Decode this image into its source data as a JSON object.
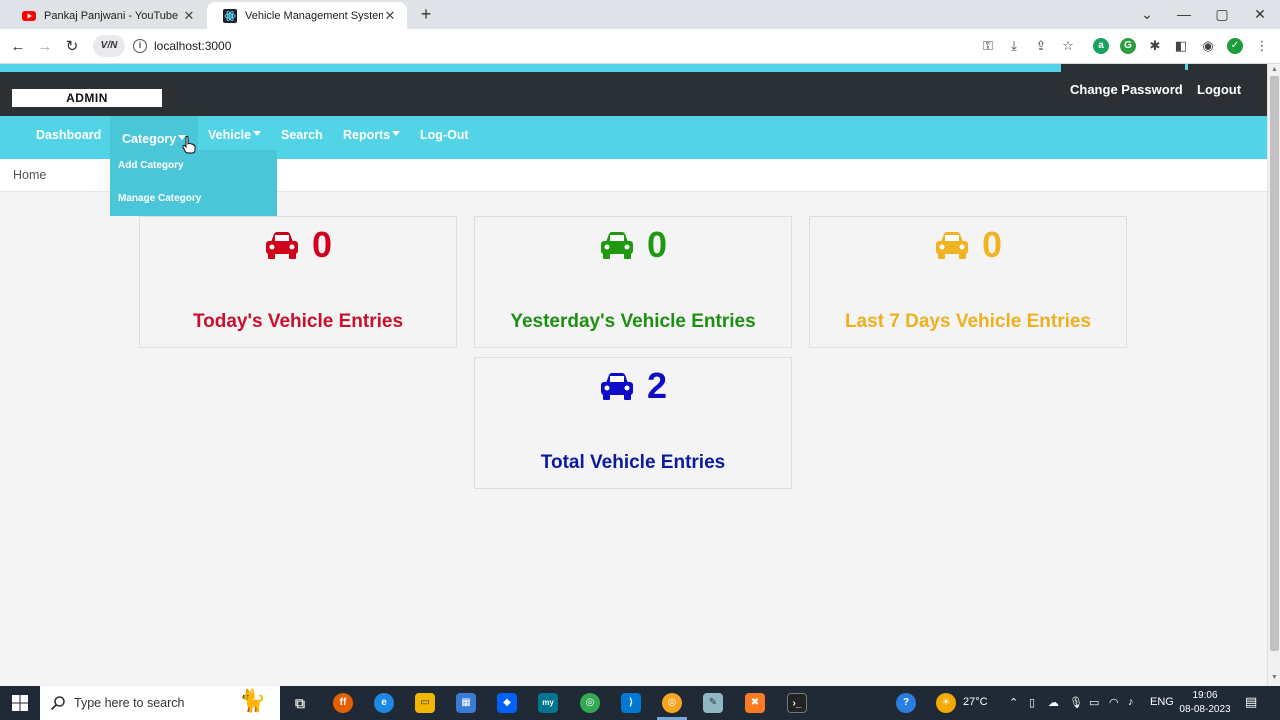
{
  "browser": {
    "tabs": [
      {
        "title": "Pankaj Panjwani - YouTube",
        "active": false
      },
      {
        "title": "Vehicle Management System",
        "active": true
      }
    ],
    "url": "localhost:3000",
    "vpn_label": "V/N"
  },
  "header": {
    "admin_label": "ADMIN",
    "change_password": "Change Password",
    "logout": "Logout"
  },
  "menu": {
    "dashboard": "Dashboard",
    "category": "Category",
    "vehicle": "Vehicle",
    "search": "Search",
    "reports": "Reports",
    "logout": "Log-Out",
    "category_dropdown": [
      "Add Category",
      "Manage Category"
    ]
  },
  "breadcrumb": "Home",
  "cards": [
    {
      "count": "0",
      "label": "Today's Vehicle Entries",
      "color": "#d0021b"
    },
    {
      "count": "0",
      "label": "Yesterday's Vehicle Entries",
      "color": "#1f9a10"
    },
    {
      "count": "0",
      "label": "Last 7 Days Vehicle Entries",
      "color": "#f0b323"
    },
    {
      "count": "2",
      "label": "Total Vehicle Entries",
      "color": "#0d0dc8"
    }
  ],
  "taskbar": {
    "search_placeholder": "Type here to search",
    "weather": "27°C",
    "language": "ENG",
    "time": "19:06",
    "date": "08-08-2023"
  },
  "colors": {
    "accent": "#52d3e6",
    "header_dark": "#2b3035"
  }
}
